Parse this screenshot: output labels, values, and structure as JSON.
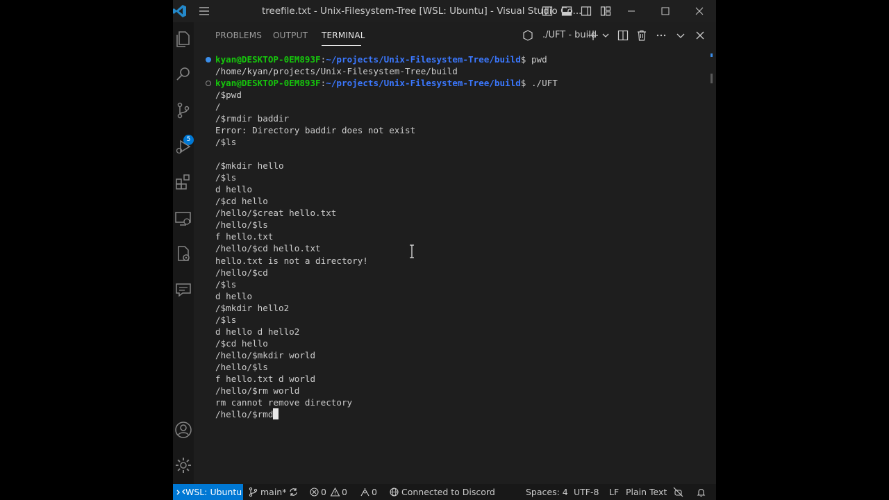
{
  "window": {
    "title": "treefile.txt - Unix-Filesystem-Tree [WSL: Ubuntu] - Visual Studio Co..."
  },
  "activity_bar": {
    "source_control_badge": "5"
  },
  "panel": {
    "tabs": [
      {
        "label": "PROBLEMS"
      },
      {
        "label": "OUTPUT"
      },
      {
        "label": "TERMINAL"
      }
    ],
    "active_tab": "TERMINAL",
    "terminal_name": "./UFT - build"
  },
  "terminal": {
    "prompt1": {
      "user": "kyan@DESKTOP-0EM893F",
      "path": "~/projects/Unix-Filesystem-Tree/build",
      "command": "$ pwd"
    },
    "output1": "/home/kyan/projects/Unix-Filesystem-Tree/build",
    "prompt2": {
      "user": "kyan@DESKTOP-0EM893F",
      "path": "~/projects/Unix-Filesystem-Tree/build",
      "command": "$ ./UFT"
    },
    "lines": [
      "/$pwd",
      "/",
      "/$rmdir baddir",
      "Error: Directory baddir does not exist",
      "/$ls",
      "",
      "/$mkdir hello",
      "/$ls",
      "d hello",
      "/$cd hello",
      "/hello/$creat hello.txt",
      "/hello/$ls",
      "f hello.txt",
      "/hello/$cd hello.txt",
      "hello.txt is not a directory!",
      "/hello/$cd",
      "/$ls",
      "d hello",
      "/$mkdir hello2",
      "/$ls",
      "d hello d hello2",
      "/$cd hello",
      "/hello/$mkdir world",
      "/hello/$ls",
      "f hello.txt d world",
      "/hello/$rm world",
      "rm cannot remove directory"
    ],
    "current_input": "/hello/$rmd"
  },
  "status_bar": {
    "remote": "WSL: Ubuntu",
    "branch": "main*",
    "errors": "0",
    "warnings": "0",
    "ports": "0",
    "discord": "Connected to Discord",
    "spaces": "Spaces: 4",
    "encoding": "UTF-8",
    "eol": "LF",
    "language": "Plain Text"
  },
  "colors": {
    "accent": "#0078d4",
    "prompt_user": "#16c60c",
    "prompt_path": "#3b78ff",
    "background": "#1e1e1e"
  }
}
